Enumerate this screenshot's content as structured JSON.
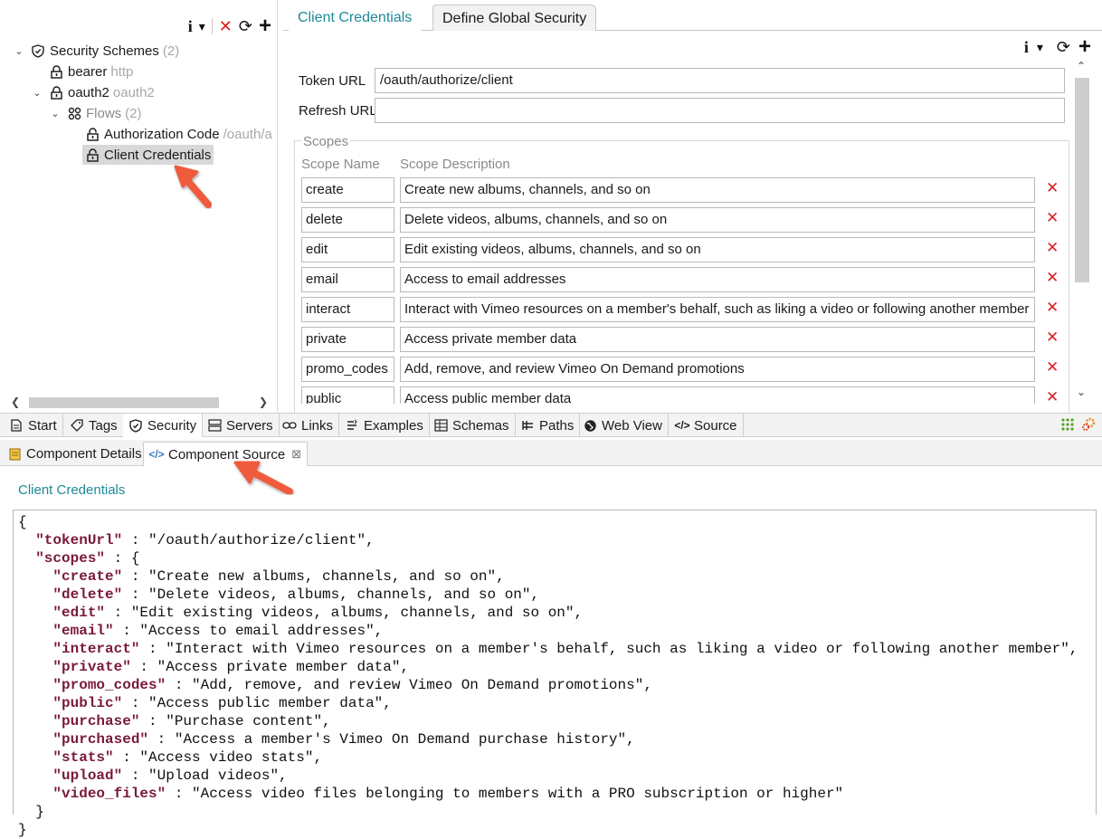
{
  "tree": {
    "toolbar": {
      "info": "i",
      "dropdown": "▾",
      "delete": "✕",
      "refresh": "⟳",
      "add": "+"
    },
    "items": [
      {
        "label": "Security Schemes",
        "sub": "(2)",
        "icon": "shield-icon",
        "expanded": true
      },
      {
        "label": "bearer",
        "sub": "http",
        "icon": "lock-icon"
      },
      {
        "label": "oauth2",
        "sub": "oauth2",
        "icon": "lock-icon",
        "expanded": true
      },
      {
        "label": "Flows",
        "sub": "(2)",
        "icon": "flows-icon",
        "expanded": true
      },
      {
        "label": "Authorization Code",
        "sub": "/oauth/a",
        "icon": "unlock-icon"
      },
      {
        "label": "Client Credentials",
        "sub": "",
        "icon": "unlock-icon",
        "selected": true
      }
    ]
  },
  "editor": {
    "tabs": [
      {
        "label": "Client Credentials",
        "active": true
      },
      {
        "label": "Define Global Security",
        "active": false
      }
    ],
    "token_url_label": "Token URL",
    "token_url_value": "/oauth/authorize/client",
    "refresh_url_label": "Refresh URL",
    "refresh_url_value": "",
    "scopes_legend": "Scopes",
    "scope_name_header": "Scope Name",
    "scope_desc_header": "Scope Description",
    "scopes": [
      {
        "name": "create",
        "description": "Create new albums, channels, and so on"
      },
      {
        "name": "delete",
        "description": "Delete videos, albums, channels, and so on"
      },
      {
        "name": "edit",
        "description": "Edit existing videos, albums, channels, and so on"
      },
      {
        "name": "email",
        "description": "Access to email addresses"
      },
      {
        "name": "interact",
        "description": "Interact with Vimeo resources on a member's behalf, such as liking a video or following another member"
      },
      {
        "name": "private",
        "description": "Access private member data"
      },
      {
        "name": "promo_codes",
        "description": "Add, remove, and review Vimeo On Demand promotions"
      },
      {
        "name": "public",
        "description": "Access public member data"
      }
    ]
  },
  "bottom_tabs": [
    {
      "label": "Start",
      "icon": "document-icon"
    },
    {
      "label": "Tags",
      "icon": "tag-icon"
    },
    {
      "label": "Security",
      "icon": "shield-icon",
      "active": true
    },
    {
      "label": "Servers",
      "icon": "server-icon"
    },
    {
      "label": "Links",
      "icon": "link-icon"
    },
    {
      "label": "Examples",
      "icon": "examples-icon"
    },
    {
      "label": "Schemas",
      "icon": "schemas-icon"
    },
    {
      "label": "Paths",
      "icon": "paths-icon"
    },
    {
      "label": "Web View",
      "icon": "globe-icon"
    },
    {
      "label": "Source",
      "icon": "code-icon"
    }
  ],
  "view_tabs": [
    {
      "label": "Component Details",
      "icon": "details-icon",
      "active": false
    },
    {
      "label": "Component Source",
      "icon": "code-icon",
      "active": true,
      "close": "⊠"
    }
  ],
  "source": {
    "title": "Client Credentials",
    "tokenUrl": "/oauth/authorize/client",
    "scopes": [
      {
        "key": "create",
        "value": "Create new albums, channels, and so on"
      },
      {
        "key": "delete",
        "value": "Delete videos, albums, channels, and so on"
      },
      {
        "key": "edit",
        "value": "Edit existing videos, albums, channels, and so on"
      },
      {
        "key": "email",
        "value": "Access to email addresses"
      },
      {
        "key": "interact",
        "value": "Interact with Vimeo resources on a member's behalf, such as liking a video or following another member"
      },
      {
        "key": "private",
        "value": "Access private member data"
      },
      {
        "key": "promo_codes",
        "value": "Add, remove, and review Vimeo On Demand promotions"
      },
      {
        "key": "public",
        "value": "Access public member data"
      },
      {
        "key": "purchase",
        "value": "Purchase content"
      },
      {
        "key": "purchased",
        "value": "Access a member's Vimeo On Demand purchase history"
      },
      {
        "key": "stats",
        "value": "Access video stats"
      },
      {
        "key": "upload",
        "value": "Upload videos"
      },
      {
        "key": "video_files",
        "value": "Access video files belonging to members with a PRO subscription or higher"
      }
    ]
  },
  "colors": {
    "accent": "#1d8a96",
    "delete": "#d92020",
    "json_key": "#7a1a3a",
    "annotation_arrow": "#f05a3c"
  }
}
